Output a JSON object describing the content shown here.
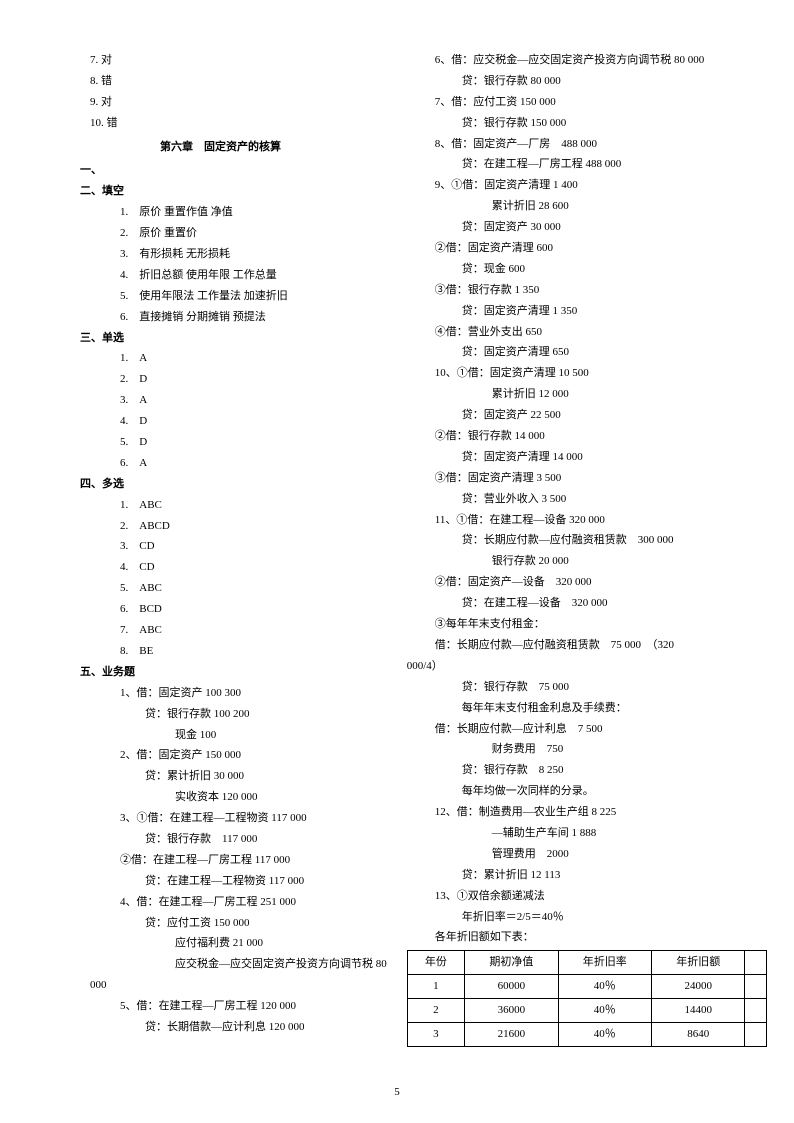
{
  "left": {
    "tf": [
      "7. 对",
      "8. 错",
      "9. 对",
      "10. 错"
    ],
    "chapter": "第六章　固定资产的核算",
    "s1": "一、",
    "s2": "二、填空",
    "fill": [
      "1.　原价 重置作值 净值",
      "2.　原价 重置价",
      "3.　有形损耗 无形损耗",
      "4.　折旧总额 使用年限 工作总量",
      "5.　使用年限法 工作量法 加速折旧",
      "6.　直接摊销 分期摊销 预提法"
    ],
    "s3": "三、单选",
    "single": [
      "1.　A",
      "2.　D",
      "3.　A",
      "4.　D",
      "5.　D",
      "6.　A"
    ],
    "s4": "四、多选",
    "multi": [
      "1.　ABC",
      "2.　ABCD",
      "3.　CD",
      "4.　CD",
      "5.　ABC",
      "6.　BCD",
      "7.　ABC",
      "8.　BE"
    ],
    "s5": "五、业务题",
    "biz": [
      {
        "t": "1、借：固定资产 100 300",
        "i": 2
      },
      {
        "t": "贷：银行存款 100 200",
        "i": 3
      },
      {
        "t": "现金 100",
        "i": 4
      },
      {
        "t": "2、借：固定资产 150 000",
        "i": 2
      },
      {
        "t": "贷：累计折旧 30 000",
        "i": 3
      },
      {
        "t": "实收资本 120 000",
        "i": 4
      },
      {
        "t": "3、①借：在建工程—工程物资 117 000",
        "i": 2
      },
      {
        "t": "贷：银行存款　117 000",
        "i": 3
      },
      {
        "t": "②借：在建工程—厂房工程 117 000",
        "i": 2
      },
      {
        "t": "贷：在建工程—工程物资 117 000",
        "i": 3
      },
      {
        "t": "4、借：在建工程—厂房工程 251 000",
        "i": 2
      },
      {
        "t": "贷：应付工资 150 000",
        "i": 3
      },
      {
        "t": "应付福利费 21 000",
        "i": 4
      },
      {
        "t": "应交税金—应交固定资产投资方向调节税 80",
        "i": 4
      },
      {
        "t": "000",
        "i": 1
      },
      {
        "t": "5、借：在建工程—厂房工程 120 000",
        "i": 2
      },
      {
        "t": "贷：长期借款—应计利息 120 000",
        "i": 3
      }
    ]
  },
  "right": {
    "lines": [
      {
        "t": "6、借：应交税金—应交固定资产投资方向调节税 80 000",
        "i": 1
      },
      {
        "t": "贷：银行存款 80 000",
        "i": 2
      },
      {
        "t": "7、借：应付工资 150 000",
        "i": 1
      },
      {
        "t": "贷：银行存款 150 000",
        "i": 2
      },
      {
        "t": "8、借：固定资产—厂房　488 000",
        "i": 1
      },
      {
        "t": "贷：在建工程—厂房工程 488 000",
        "i": 2
      },
      {
        "t": "9、①借：固定资产清理 1 400",
        "i": 1
      },
      {
        "t": "累计折旧 28 600",
        "i": 3
      },
      {
        "t": "贷：固定资产 30 000",
        "i": 2
      },
      {
        "t": "②借：固定资产清理 600",
        "i": 1
      },
      {
        "t": "贷：现金 600",
        "i": 2
      },
      {
        "t": "③借：银行存款 1 350",
        "i": 1
      },
      {
        "t": "贷：固定资产清理 1 350",
        "i": 2
      },
      {
        "t": "④借：营业外支出 650",
        "i": 1
      },
      {
        "t": "贷：固定资产清理 650",
        "i": 2
      },
      {
        "t": "10、①借：固定资产清理 10 500",
        "i": 1
      },
      {
        "t": "累计折旧 12 000",
        "i": 3
      },
      {
        "t": "贷：固定资产 22 500",
        "i": 2
      },
      {
        "t": "②借：银行存款 14 000",
        "i": 1
      },
      {
        "t": "贷：固定资产清理 14 000",
        "i": 2
      },
      {
        "t": "③借：固定资产清理 3 500",
        "i": 1
      },
      {
        "t": "贷：营业外收入 3 500",
        "i": 2
      },
      {
        "t": "11、①借：在建工程—设备 320 000",
        "i": 1
      },
      {
        "t": "贷：长期应付款—应付融资租赁款　300 000",
        "i": 2
      },
      {
        "t": "银行存款 20 000",
        "i": 3
      },
      {
        "t": "②借：固定资产—设备　320 000",
        "i": 1
      },
      {
        "t": "贷：在建工程—设备　320 000",
        "i": 2
      },
      {
        "t": "③每年年末支付租金：",
        "i": 1
      },
      {
        "t": "借：长期应付款—应付融资租赁款　75 000　（320",
        "i": 1
      },
      {
        "t": "000/4）",
        "i": 0
      },
      {
        "t": "贷：银行存款　75 000",
        "i": 2
      },
      {
        "t": "每年年末支付租金利息及手续费：",
        "i": 2
      },
      {
        "t": "借：长期应付款—应计利息　7 500",
        "i": 1
      },
      {
        "t": "财务费用　750",
        "i": 3
      },
      {
        "t": "贷：银行存款　8 250",
        "i": 2
      },
      {
        "t": "每年均做一次同样的分录。",
        "i": 2
      },
      {
        "t": "12、借：制造费用—农业生产组 8 225",
        "i": 1
      },
      {
        "t": "—辅助生产车间 1 888",
        "i": 3
      },
      {
        "t": "管理费用　2000",
        "i": 3
      },
      {
        "t": "贷：累计折旧 12 113",
        "i": 2
      },
      {
        "t": "13、①双倍余额递减法",
        "i": 1
      },
      {
        "t": "年折旧率＝2/5＝40％",
        "i": 2
      },
      {
        "t": "各年折旧额如下表：",
        "i": 1
      }
    ],
    "table": {
      "head": [
        "年份",
        "期初净值",
        "年折旧率",
        "年折旧额"
      ],
      "rows": [
        [
          "1",
          "60000",
          "40％",
          "24000"
        ],
        [
          "2",
          "36000",
          "40％",
          "14400"
        ],
        [
          "3",
          "21600",
          "40％",
          "8640"
        ]
      ]
    }
  },
  "pageNum": "5"
}
